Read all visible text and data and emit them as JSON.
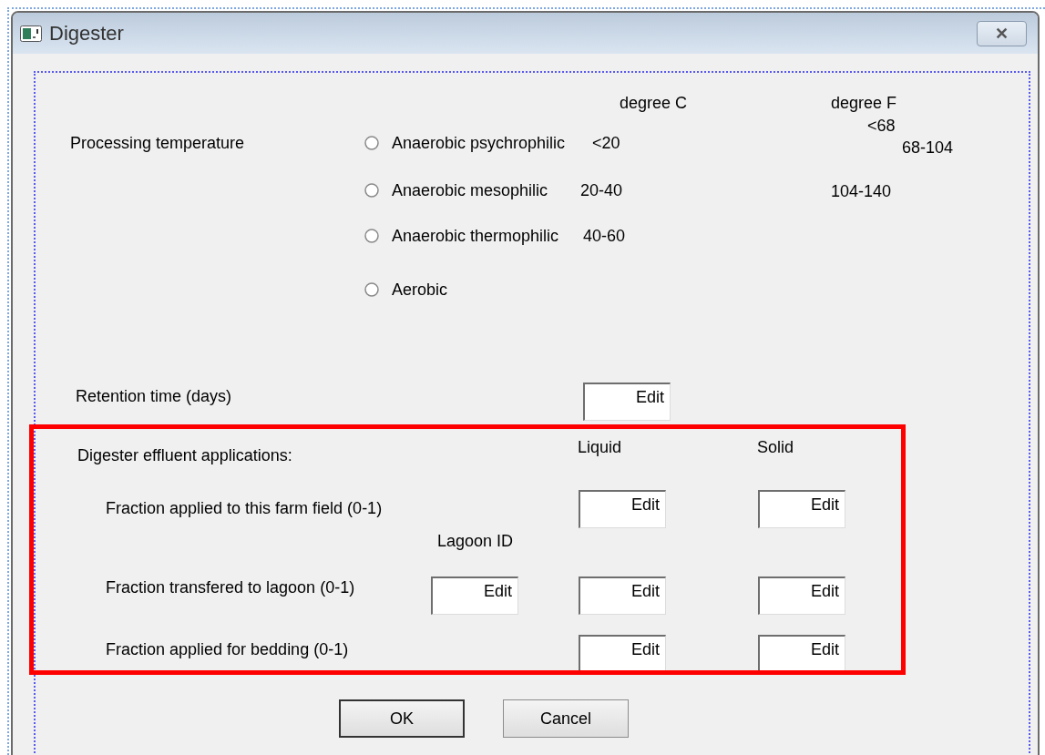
{
  "window": {
    "title": "Digester",
    "close": "✕"
  },
  "processing": {
    "label": "Processing temperature",
    "header_c": "degree C",
    "header_f": "degree F",
    "options": [
      {
        "label": "Anaerobic psychrophilic",
        "celsius": "<20",
        "selected": false
      },
      {
        "label": "Anaerobic mesophilic",
        "celsius": "20-40",
        "selected": false
      },
      {
        "label": "Anaerobic thermophilic",
        "celsius": "40-60",
        "selected": false
      },
      {
        "label": "Aerobic",
        "selected": false
      }
    ],
    "fahrenheit": [
      "<68",
      "68-104",
      "104-140"
    ]
  },
  "retention": {
    "label": "Retention time (days)",
    "value": "Edit"
  },
  "effluent": {
    "label": "Digester effluent applications:",
    "liquid_header": "Liquid",
    "solid_header": "Solid",
    "lagoon_header": "Lagoon ID",
    "highlight": {
      "kind": "frame"
    },
    "rows": [
      {
        "label": "Fraction applied to this farm field (0-1)",
        "liquid": "Edit",
        "solid": "Edit"
      },
      {
        "label": "Fraction transfered to lagoon (0-1)",
        "lagoon_id": "Edit",
        "liquid": "Edit",
        "solid": "Edit"
      },
      {
        "label": "Fraction applied for bedding (0-1)",
        "liquid": "Edit",
        "solid": "Edit"
      }
    ]
  },
  "buttons": [
    {
      "label": "OK",
      "default": true
    },
    {
      "label": "Cancel",
      "default": false
    }
  ]
}
